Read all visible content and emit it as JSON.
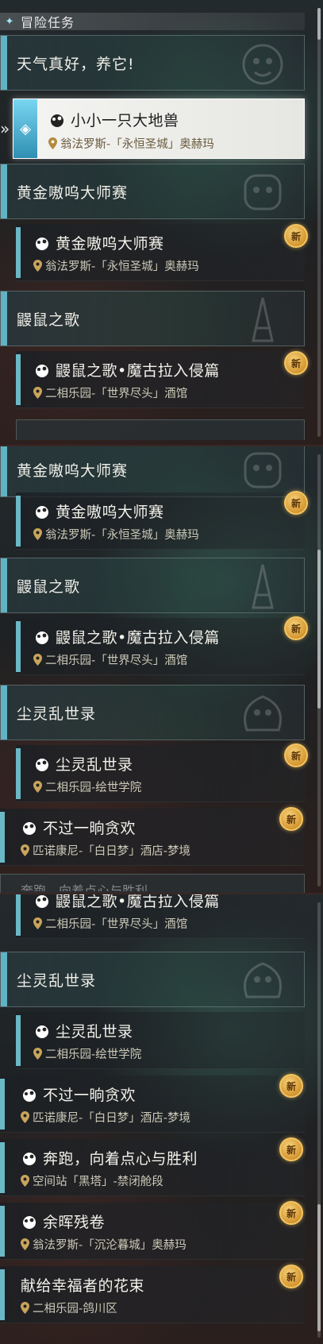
{
  "header": {
    "title": "冒险任务",
    "icon": "diamond-icon"
  },
  "panel1": {
    "items": [
      {
        "kind": "group",
        "label": "天气真好，养它!"
      },
      {
        "kind": "selected",
        "name": "小小一只大地兽",
        "location": "翁法罗斯-「永恒圣城」奥赫玛"
      },
      {
        "kind": "group",
        "label": "黄金嗷呜大师赛"
      },
      {
        "kind": "item",
        "name": "黄金嗷呜大师赛",
        "location": "翁法罗斯-「永恒圣城」奥赫玛",
        "badge": "新"
      },
      {
        "kind": "group",
        "label": "鼹鼠之歌"
      },
      {
        "kind": "item",
        "name": "鼹鼠之歌•魔古拉入侵篇",
        "location": "二相乐园-「世界尽头」酒馆",
        "badge": "新"
      }
    ]
  },
  "panel2": {
    "items": [
      {
        "kind": "group",
        "label": "黄金嗷呜大师赛"
      },
      {
        "kind": "item",
        "name": "黄金嗷呜大师赛",
        "location": "翁法罗斯-「永恒圣城」奥赫玛",
        "badge": "新"
      },
      {
        "kind": "group",
        "label": "鼹鼠之歌"
      },
      {
        "kind": "item",
        "name": "鼹鼠之歌•魔古拉入侵篇",
        "location": "二相乐园-「世界尽头」酒馆",
        "badge": "新"
      },
      {
        "kind": "group",
        "label": "尘灵乱世录"
      },
      {
        "kind": "item",
        "name": "尘灵乱世录",
        "location": "二相乐园-绘世学院",
        "badge": "新"
      },
      {
        "kind": "item-flat",
        "name": "不过一晌贪欢",
        "location": "匹诺康尼-「白日梦」酒店-梦境",
        "badge": "新"
      },
      {
        "kind": "cut",
        "name": "奔跑，向着点心与胜利"
      }
    ]
  },
  "panel3": {
    "items": [
      {
        "kind": "item",
        "name": "鼹鼠之歌•魔古拉入侵篇",
        "location": "二相乐园-「世界尽头」酒馆"
      },
      {
        "kind": "group",
        "label": "尘灵乱世录"
      },
      {
        "kind": "item",
        "name": "尘灵乱世录",
        "location": "二相乐园-绘世学院"
      },
      {
        "kind": "item-flat",
        "name": "不过一晌贪欢",
        "location": "匹诺康尼-「白日梦」酒店-梦境",
        "badge": "新"
      },
      {
        "kind": "item-flat",
        "name": "奔跑，向着点心与胜利",
        "location": "空间站「黑塔」-禁闭舱段",
        "badge": "新"
      },
      {
        "kind": "item-flat",
        "name": "余晖残卷",
        "location": "翁法罗斯-「沉沦暮城」奥赫玛",
        "badge": "新"
      },
      {
        "kind": "item-flat-noicon",
        "name": "献给幸福者的花束",
        "location": "二相乐园-鸽川区",
        "badge": "新"
      }
    ]
  },
  "colors": {
    "accent": "#5fb3c4",
    "badge": "#e2a640",
    "selected_bg": "#f2f2ef"
  },
  "icons": {
    "quest": "paw-icon",
    "location": "pin-icon",
    "new": "new-badge-icon"
  }
}
